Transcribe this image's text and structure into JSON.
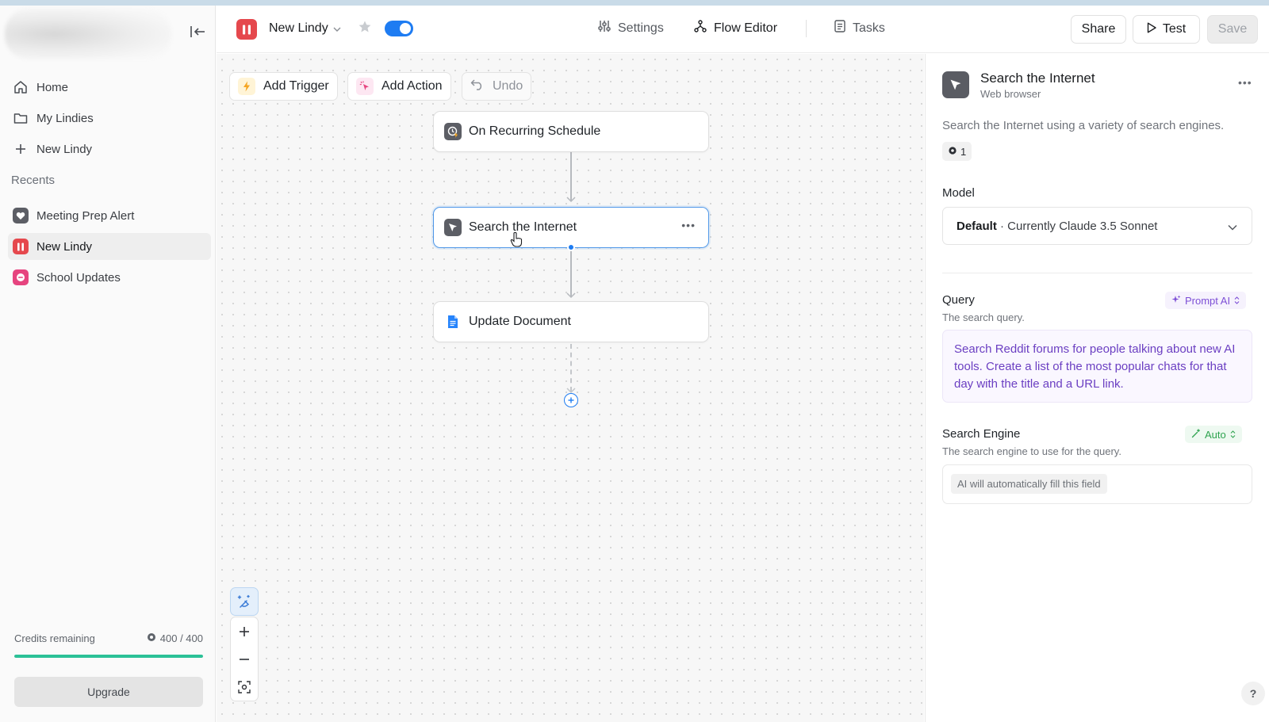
{
  "sidebar": {
    "nav": [
      {
        "label": "Home",
        "icon": "home-icon"
      },
      {
        "label": "My Lindies",
        "icon": "folder-icon"
      },
      {
        "label": "New Lindy",
        "icon": "plus-icon"
      }
    ],
    "recents_label": "Recents",
    "recents": [
      {
        "label": "Meeting Prep Alert",
        "color": "#5c5e65"
      },
      {
        "label": "New Lindy",
        "color": "#e5484d"
      },
      {
        "label": "School Updates",
        "color": "#e6447f"
      }
    ],
    "credits_label": "Credits remaining",
    "credits_value": "400 / 400",
    "credits_fraction": 1.0,
    "upgrade_label": "Upgrade"
  },
  "header": {
    "lindy_name": "New Lindy",
    "enabled": true,
    "tabs": [
      {
        "label": "Settings",
        "icon": "sliders-icon"
      },
      {
        "label": "Flow Editor",
        "icon": "flow-icon"
      },
      {
        "label": "Tasks",
        "icon": "document-icon"
      }
    ],
    "active_tab": "Flow Editor",
    "share_label": "Share",
    "test_label": "Test",
    "save_label": "Save"
  },
  "canvas": {
    "add_trigger_label": "Add Trigger",
    "add_action_label": "Add Action",
    "undo_label": "Undo",
    "nodes": [
      {
        "label": "On Recurring Schedule",
        "icon": "clock-icon"
      },
      {
        "label": "Search the Internet",
        "icon": "cursor-icon",
        "selected": true
      },
      {
        "label": "Update Document",
        "icon": "google-doc-icon"
      }
    ]
  },
  "panel": {
    "title": "Search the Internet",
    "subtitle": "Web browser",
    "description": "Search the Internet using a variety of search engines.",
    "badge_count": "1",
    "model_label": "Model",
    "model_value_bold": "Default",
    "model_value_rest": " · Currently Claude 3.5 Sonnet",
    "query_label": "Query",
    "query_help": "The search query.",
    "query_mode": "Prompt AI",
    "query_text": "Search Reddit forums for people talking about new AI tools. Create a list of the most popular chats for that day with the title and a URL link.",
    "engine_label": "Search Engine",
    "engine_help": "The search engine to use for the query.",
    "engine_mode": "Auto",
    "engine_placeholder": "AI will automatically fill this field"
  },
  "colors": {
    "accent_blue": "#1e7cf2",
    "lindy_red": "#e5484d",
    "credits_green": "#2cc197",
    "prompt_purple": "#7d4fd6",
    "auto_green": "#2ea34f"
  }
}
